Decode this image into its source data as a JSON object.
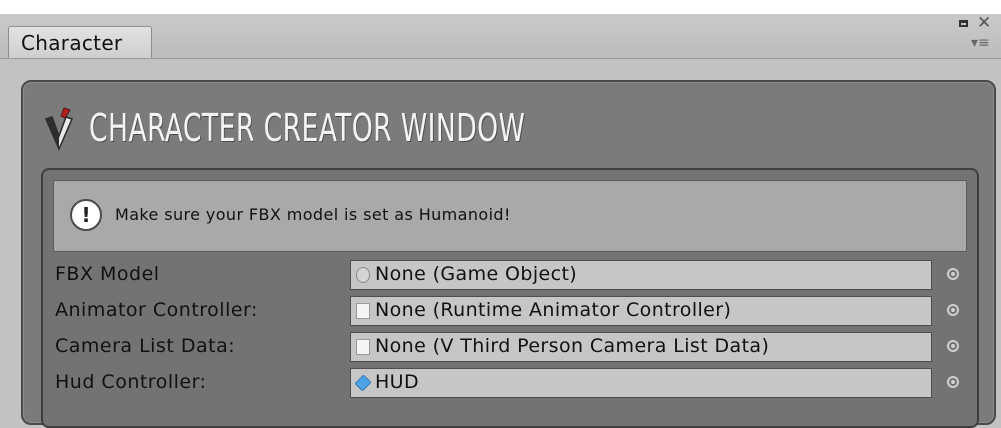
{
  "tab": {
    "label": "Character"
  },
  "icons": {
    "close": "✕",
    "menu": "▾≡"
  },
  "header": {
    "title": "CHARACTER CREATOR WINDOW"
  },
  "help": {
    "icon_glyph": "!",
    "text": "Make sure your FBX model is set as Humanoid!"
  },
  "fields": [
    {
      "label": "FBX Model",
      "value": "None (Game Object)",
      "icon": "game-object-icon"
    },
    {
      "label": "Animator Controller:",
      "value": "None (Runtime Animator Controller)",
      "icon": "asset-file-icon"
    },
    {
      "label": "Camera List Data:",
      "value": "None (V Third Person Camera List Data)",
      "icon": "asset-file-icon"
    },
    {
      "label": "Hud Controller:",
      "value": "HUD",
      "icon": "prefab-icon"
    }
  ],
  "colors": {
    "background": "#c2c2c2",
    "panel": "#7b7b7b",
    "field": "#c6c6c6",
    "prefab": "#4da3e8"
  }
}
